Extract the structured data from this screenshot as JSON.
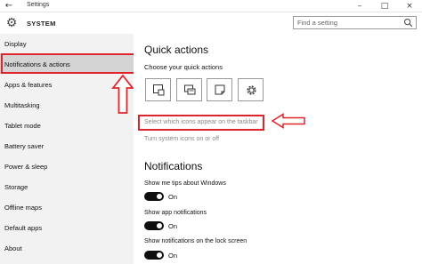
{
  "window": {
    "title": "Settings",
    "back_icon": "arrow-left-icon",
    "controls": [
      "minimize-icon",
      "maximize-icon",
      "close-icon"
    ]
  },
  "header": {
    "icon": "gear-icon",
    "title": "SYSTEM",
    "search_placeholder": "Find a setting"
  },
  "sidebar": {
    "items": [
      {
        "label": "Display"
      },
      {
        "label": "Notifications & actions",
        "selected": true
      },
      {
        "label": "Apps & features"
      },
      {
        "label": "Multitasking"
      },
      {
        "label": "Tablet mode"
      },
      {
        "label": "Battery saver"
      },
      {
        "label": "Power & sleep"
      },
      {
        "label": "Storage"
      },
      {
        "label": "Offline maps"
      },
      {
        "label": "Default apps"
      },
      {
        "label": "About"
      }
    ]
  },
  "main": {
    "quick_actions": {
      "heading": "Quick actions",
      "choose_label": "Choose your quick actions",
      "tiles": [
        "tablet-mode-icon",
        "connect-icon",
        "note-icon",
        "settings-gear-icon"
      ]
    },
    "links": {
      "select_icons": "Select which icons appear on the taskbar",
      "system_icons": "Turn system icons on or off"
    },
    "notifications": {
      "heading": "Notifications",
      "options": [
        {
          "label": "Show me tips about Windows",
          "state": "On"
        },
        {
          "label": "Show app notifications",
          "state": "On"
        },
        {
          "label": "Show notifications on the lock screen",
          "state": "On"
        }
      ]
    }
  },
  "annotations": {
    "highlight_color": "#e0242b"
  }
}
